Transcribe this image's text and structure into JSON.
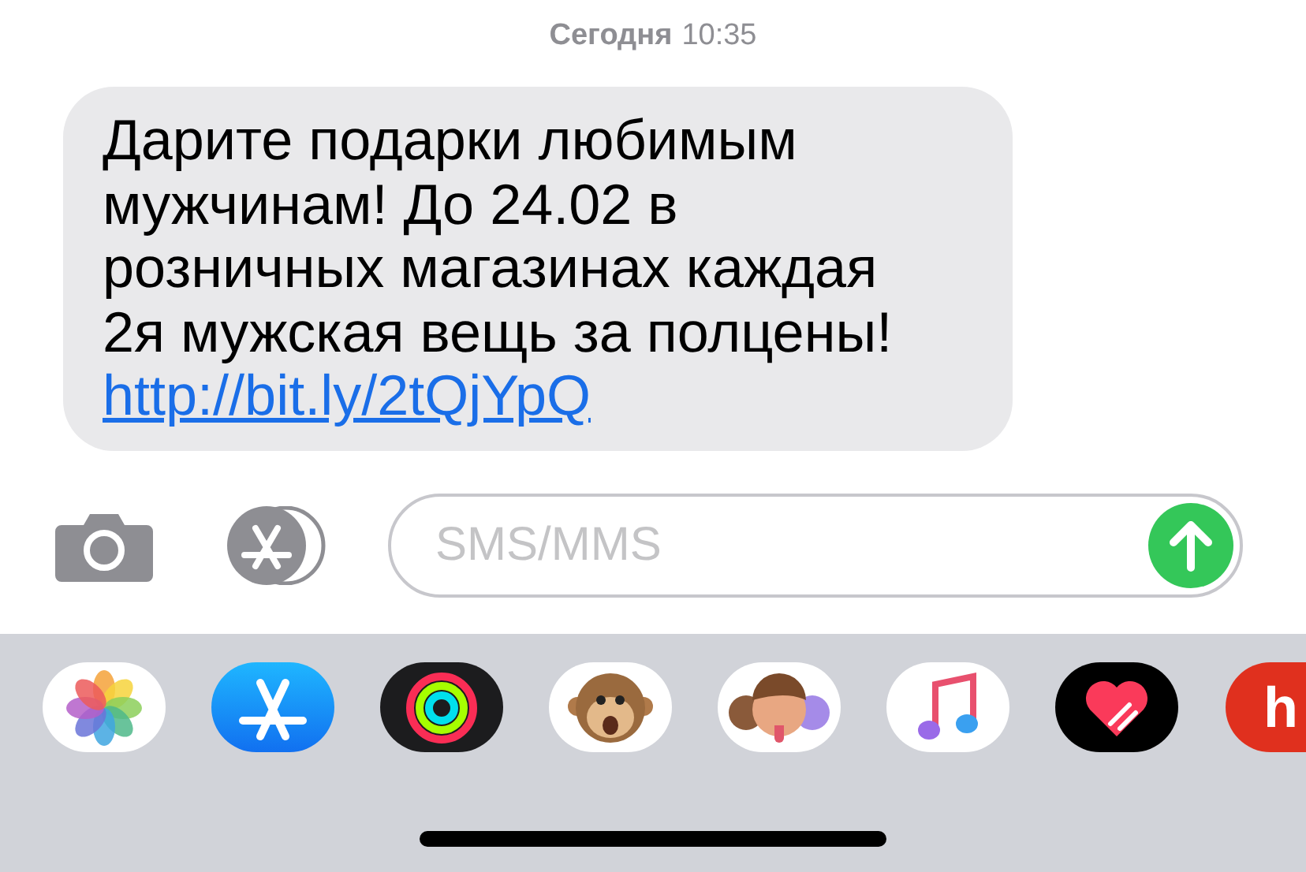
{
  "header": {
    "day": "Сегодня",
    "time": "10:35"
  },
  "message": {
    "text": "Дарите подарки любимым мужчинам! До 24.02 в розничных магазинах каждая 2я мужская вещь за полцены!",
    "link": "http://bit.ly/2tQjYpQ"
  },
  "composer": {
    "placeholder": "SMS/MMS"
  },
  "apps": [
    {
      "kind": "photos"
    },
    {
      "kind": "store"
    },
    {
      "kind": "activity"
    },
    {
      "kind": "monkey"
    },
    {
      "kind": "memoji"
    },
    {
      "kind": "music"
    },
    {
      "kind": "heart"
    },
    {
      "kind": "partial",
      "label": "h"
    }
  ]
}
